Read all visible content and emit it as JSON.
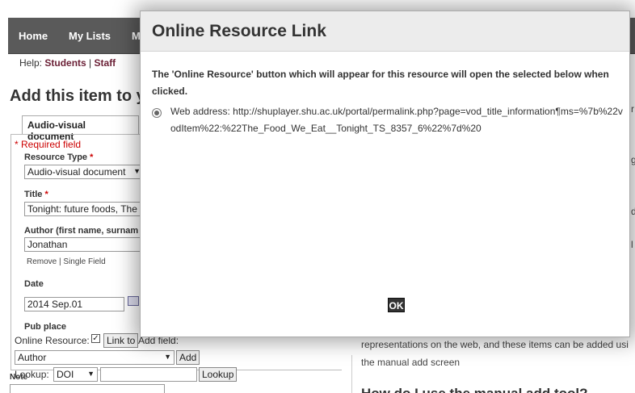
{
  "nav": {
    "home": "Home",
    "my_lists": "My Lists",
    "partial": "M"
  },
  "help": {
    "prefix": "Help:",
    "students": "Students",
    "sep": "|",
    "staff": "Staff"
  },
  "page": {
    "title": "Add this item to y"
  },
  "form": {
    "tab_label": "Audio-visual document",
    "required_note": "* Required field",
    "resource_type_label": "Resource Type",
    "resource_type_value": "Audio-visual document",
    "title_label": "Title",
    "title_value": "Tonight: future foods, The",
    "author_label": "Author (first name, surnam",
    "author_value": "Jonathan",
    "remove_link": "Remove",
    "single_field_link": "Single Field",
    "date_label": "Date",
    "date_value": "2014 Sep.01",
    "pub_place_label": "Pub place",
    "online_resource_label": "Online Resource:",
    "link_to_button": "Link to",
    "add_field_label": "Add field:",
    "add_field_value": "Author",
    "add_button": "Add",
    "note_label": "Note",
    "lookup_label": "Lookup:",
    "lookup_type": "DOI",
    "lookup_button": "Lookup",
    "star": "*"
  },
  "right": {
    "line1": "representations on the web, and these items can be added usi",
    "line2": "the manual add screen",
    "heading": "How do I use the manual add tool?",
    "peek_g": "g",
    "peek_d": "d",
    "peek_l": "l",
    "peek_r": "r"
  },
  "modal": {
    "title": "Online Resource Link",
    "description": "The 'Online Resource' button which will appear for this resource will open the selected below when clicked.",
    "web_address": "Web address: http://shuplayer.shu.ac.uk/portal/permalink.php?page=vod_title_information¶ms=%7b%22vodItem%22:%22The_Food_We_Eat__Tonight_TS_8357_6%22%7d%20",
    "ok_button": "OK"
  }
}
